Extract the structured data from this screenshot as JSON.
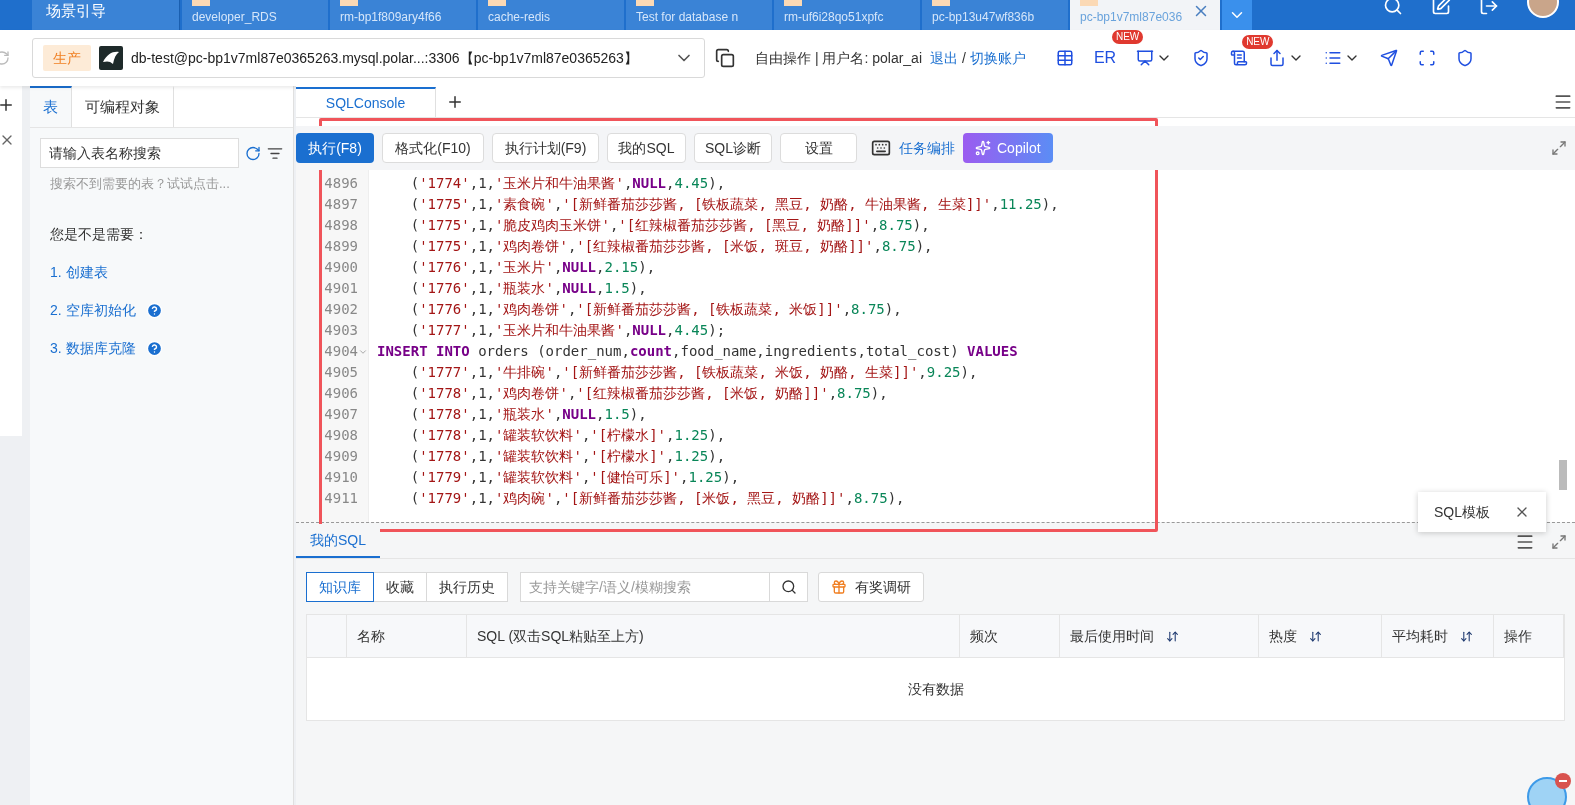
{
  "top_bar": {
    "guide": "场景引导",
    "tabs": [
      {
        "subtitle": "developer_RDS",
        "selected": false
      },
      {
        "subtitle": "rm-bp1f809ary4f66",
        "selected": false
      },
      {
        "subtitle": "cache-redis",
        "selected": false
      },
      {
        "subtitle": "Test for database n",
        "selected": false
      },
      {
        "subtitle": "rm-uf6i28qo51xpfc",
        "selected": false
      },
      {
        "subtitle": "pc-bp13u47wf836b",
        "selected": false
      },
      {
        "subtitle": "pc-bp1v7ml87e036",
        "selected": true
      }
    ]
  },
  "connection": {
    "env_badge": "生产",
    "address": "db-test@pc-bp1v7ml87e0365263.mysql.polar...:3306【pc-bp1v7ml87e0365263】",
    "mode": "自由操作 | 用户名: polar_ai",
    "logout": "退出",
    "separator": "/",
    "switch_account": "切换账户",
    "er_label": "ER",
    "er_badge": "NEW",
    "notes_badge": "NEW"
  },
  "sidebar": {
    "tabs": [
      {
        "label": "表",
        "selected": true
      },
      {
        "label": "可编程对象",
        "selected": false
      }
    ],
    "search": {
      "placeholder": "请输入表名称搜索"
    },
    "hint": "搜索不到需要的表？试试点击...",
    "suggestion_title": "您是不是需要：",
    "suggestions": [
      {
        "label": "1. 创建表",
        "help": false
      },
      {
        "label": "2. 空库初始化",
        "help": true
      },
      {
        "label": "3. 数据库克隆",
        "help": true
      }
    ]
  },
  "editor": {
    "tabs": [
      {
        "label": "SQLConsole",
        "selected": true
      }
    ],
    "buttons": [
      {
        "label": "执行(F8)",
        "primary": true
      },
      {
        "label": "格式化(F10)",
        "primary": false
      },
      {
        "label": "执行计划(F9)",
        "primary": false
      },
      {
        "label": "我的SQL",
        "primary": false
      },
      {
        "label": "SQL诊断",
        "primary": false
      },
      {
        "label": "设置",
        "primary": false
      }
    ],
    "task_link": "任务编排",
    "copilot": "Copilot",
    "lines": [
      {
        "number": "4896",
        "fold": false,
        "tokens": [
          {
            "kind": "plain",
            "text": "    ("
          },
          {
            "kind": "string",
            "text": "'1774'"
          },
          {
            "kind": "plain",
            "text": ",1,"
          },
          {
            "kind": "string",
            "text": "'玉米片和牛油果酱'"
          },
          {
            "kind": "plain",
            "text": ","
          },
          {
            "kind": "keyword",
            "text": "NULL"
          },
          {
            "kind": "plain",
            "text": ","
          },
          {
            "kind": "number",
            "text": "4.45"
          },
          {
            "kind": "plain",
            "text": "),"
          }
        ]
      },
      {
        "number": "4897",
        "fold": false,
        "tokens": [
          {
            "kind": "plain",
            "text": "    ("
          },
          {
            "kind": "string",
            "text": "'1775'"
          },
          {
            "kind": "plain",
            "text": ",1,"
          },
          {
            "kind": "string",
            "text": "'素食碗'"
          },
          {
            "kind": "plain",
            "text": ","
          },
          {
            "kind": "string",
            "text": "'[新鲜番茄莎莎酱, [铁板蔬菜, 黑豆, 奶酪, 牛油果酱, 生菜]]'"
          },
          {
            "kind": "plain",
            "text": ","
          },
          {
            "kind": "number",
            "text": "11.25"
          },
          {
            "kind": "plain",
            "text": "),"
          }
        ]
      },
      {
        "number": "4898",
        "fold": false,
        "tokens": [
          {
            "kind": "plain",
            "text": "    ("
          },
          {
            "kind": "string",
            "text": "'1775'"
          },
          {
            "kind": "plain",
            "text": ",1,"
          },
          {
            "kind": "string",
            "text": "'脆皮鸡肉玉米饼'"
          },
          {
            "kind": "plain",
            "text": ","
          },
          {
            "kind": "string",
            "text": "'[红辣椒番茄莎莎酱, [黑豆, 奶酪]]'"
          },
          {
            "kind": "plain",
            "text": ","
          },
          {
            "kind": "number",
            "text": "8.75"
          },
          {
            "kind": "plain",
            "text": "),"
          }
        ]
      },
      {
        "number": "4899",
        "fold": false,
        "tokens": [
          {
            "kind": "plain",
            "text": "    ("
          },
          {
            "kind": "string",
            "text": "'1775'"
          },
          {
            "kind": "plain",
            "text": ",1,"
          },
          {
            "kind": "string",
            "text": "'鸡肉卷饼'"
          },
          {
            "kind": "plain",
            "text": ","
          },
          {
            "kind": "string",
            "text": "'[红辣椒番茄莎莎酱, [米饭, 斑豆, 奶酪]]'"
          },
          {
            "kind": "plain",
            "text": ","
          },
          {
            "kind": "number",
            "text": "8.75"
          },
          {
            "kind": "plain",
            "text": "),"
          }
        ]
      },
      {
        "number": "4900",
        "fold": false,
        "tokens": [
          {
            "kind": "plain",
            "text": "    ("
          },
          {
            "kind": "string",
            "text": "'1776'"
          },
          {
            "kind": "plain",
            "text": ",1,"
          },
          {
            "kind": "string",
            "text": "'玉米片'"
          },
          {
            "kind": "plain",
            "text": ","
          },
          {
            "kind": "keyword",
            "text": "NULL"
          },
          {
            "kind": "plain",
            "text": ","
          },
          {
            "kind": "number",
            "text": "2.15"
          },
          {
            "kind": "plain",
            "text": "),"
          }
        ]
      },
      {
        "number": "4901",
        "fold": false,
        "tokens": [
          {
            "kind": "plain",
            "text": "    ("
          },
          {
            "kind": "string",
            "text": "'1776'"
          },
          {
            "kind": "plain",
            "text": ",1,"
          },
          {
            "kind": "string",
            "text": "'瓶装水'"
          },
          {
            "kind": "plain",
            "text": ","
          },
          {
            "kind": "keyword",
            "text": "NULL"
          },
          {
            "kind": "plain",
            "text": ","
          },
          {
            "kind": "number",
            "text": "1.5"
          },
          {
            "kind": "plain",
            "text": "),"
          }
        ]
      },
      {
        "number": "4902",
        "fold": false,
        "tokens": [
          {
            "kind": "plain",
            "text": "    ("
          },
          {
            "kind": "string",
            "text": "'1776'"
          },
          {
            "kind": "plain",
            "text": ",1,"
          },
          {
            "kind": "string",
            "text": "'鸡肉卷饼'"
          },
          {
            "kind": "plain",
            "text": ","
          },
          {
            "kind": "string",
            "text": "'[新鲜番茄莎莎酱, [铁板蔬菜, 米饭]]'"
          },
          {
            "kind": "plain",
            "text": ","
          },
          {
            "kind": "number",
            "text": "8.75"
          },
          {
            "kind": "plain",
            "text": "),"
          }
        ]
      },
      {
        "number": "4903",
        "fold": false,
        "tokens": [
          {
            "kind": "plain",
            "text": "    ("
          },
          {
            "kind": "string",
            "text": "'1777'"
          },
          {
            "kind": "plain",
            "text": ",1,"
          },
          {
            "kind": "string",
            "text": "'玉米片和牛油果酱'"
          },
          {
            "kind": "plain",
            "text": ","
          },
          {
            "kind": "keyword",
            "text": "NULL"
          },
          {
            "kind": "plain",
            "text": ","
          },
          {
            "kind": "number",
            "text": "4.45"
          },
          {
            "kind": "plain",
            "text": ");"
          }
        ]
      },
      {
        "number": "4904",
        "fold": true,
        "tokens": [
          {
            "kind": "keyword",
            "text": "INSERT INTO"
          },
          {
            "kind": "plain",
            "text": " orders (order_num,"
          },
          {
            "kind": "keyword",
            "text": "count"
          },
          {
            "kind": "plain",
            "text": ",food_name,ingredients,total_cost) "
          },
          {
            "kind": "keyword",
            "text": "VALUES"
          }
        ]
      },
      {
        "number": "4905",
        "fold": false,
        "tokens": [
          {
            "kind": "plain",
            "text": "    ("
          },
          {
            "kind": "string",
            "text": "'1777'"
          },
          {
            "kind": "plain",
            "text": ",1,"
          },
          {
            "kind": "string",
            "text": "'牛排碗'"
          },
          {
            "kind": "plain",
            "text": ","
          },
          {
            "kind": "string",
            "text": "'[新鲜番茄莎莎酱, [铁板蔬菜, 米饭, 奶酪, 生菜]]'"
          },
          {
            "kind": "plain",
            "text": ","
          },
          {
            "kind": "number",
            "text": "9.25"
          },
          {
            "kind": "plain",
            "text": "),"
          }
        ]
      },
      {
        "number": "4906",
        "fold": false,
        "tokens": [
          {
            "kind": "plain",
            "text": "    ("
          },
          {
            "kind": "string",
            "text": "'1778'"
          },
          {
            "kind": "plain",
            "text": ",1,"
          },
          {
            "kind": "string",
            "text": "'鸡肉卷饼'"
          },
          {
            "kind": "plain",
            "text": ","
          },
          {
            "kind": "string",
            "text": "'[红辣椒番茄莎莎酱, [米饭, 奶酪]]'"
          },
          {
            "kind": "plain",
            "text": ","
          },
          {
            "kind": "number",
            "text": "8.75"
          },
          {
            "kind": "plain",
            "text": "),"
          }
        ]
      },
      {
        "number": "4907",
        "fold": false,
        "tokens": [
          {
            "kind": "plain",
            "text": "    ("
          },
          {
            "kind": "string",
            "text": "'1778'"
          },
          {
            "kind": "plain",
            "text": ",1,"
          },
          {
            "kind": "string",
            "text": "'瓶装水'"
          },
          {
            "kind": "plain",
            "text": ","
          },
          {
            "kind": "keyword",
            "text": "NULL"
          },
          {
            "kind": "plain",
            "text": ","
          },
          {
            "kind": "number",
            "text": "1.5"
          },
          {
            "kind": "plain",
            "text": "),"
          }
        ]
      },
      {
        "number": "4908",
        "fold": false,
        "tokens": [
          {
            "kind": "plain",
            "text": "    ("
          },
          {
            "kind": "string",
            "text": "'1778'"
          },
          {
            "kind": "plain",
            "text": ",1,"
          },
          {
            "kind": "string",
            "text": "'罐装软饮料'"
          },
          {
            "kind": "plain",
            "text": ","
          },
          {
            "kind": "string",
            "text": "'[柠檬水]'"
          },
          {
            "kind": "plain",
            "text": ","
          },
          {
            "kind": "number",
            "text": "1.25"
          },
          {
            "kind": "plain",
            "text": "),"
          }
        ]
      },
      {
        "number": "4909",
        "fold": false,
        "tokens": [
          {
            "kind": "plain",
            "text": "    ("
          },
          {
            "kind": "string",
            "text": "'1778'"
          },
          {
            "kind": "plain",
            "text": ",1,"
          },
          {
            "kind": "string",
            "text": "'罐装软饮料'"
          },
          {
            "kind": "plain",
            "text": ","
          },
          {
            "kind": "string",
            "text": "'[柠檬水]'"
          },
          {
            "kind": "plain",
            "text": ","
          },
          {
            "kind": "number",
            "text": "1.25"
          },
          {
            "kind": "plain",
            "text": "),"
          }
        ]
      },
      {
        "number": "4910",
        "fold": false,
        "tokens": [
          {
            "kind": "plain",
            "text": "    ("
          },
          {
            "kind": "string",
            "text": "'1779'"
          },
          {
            "kind": "plain",
            "text": ",1,"
          },
          {
            "kind": "string",
            "text": "'罐装软饮料'"
          },
          {
            "kind": "plain",
            "text": ","
          },
          {
            "kind": "string",
            "text": "'[健怡可乐]'"
          },
          {
            "kind": "plain",
            "text": ","
          },
          {
            "kind": "number",
            "text": "1.25"
          },
          {
            "kind": "plain",
            "text": "),"
          }
        ]
      },
      {
        "number": "4911",
        "fold": false,
        "tokens": [
          {
            "kind": "plain",
            "text": "    ("
          },
          {
            "kind": "string",
            "text": "'1779'"
          },
          {
            "kind": "plain",
            "text": ",1,"
          },
          {
            "kind": "string",
            "text": "'鸡肉碗'"
          },
          {
            "kind": "plain",
            "text": ","
          },
          {
            "kind": "string",
            "text": "'[新鲜番茄莎莎酱, [米饭, 黑豆, 奶酪]]'"
          },
          {
            "kind": "plain",
            "text": ","
          },
          {
            "kind": "number",
            "text": "8.75"
          },
          {
            "kind": "plain",
            "text": "),"
          }
        ]
      }
    ]
  },
  "template_popup": {
    "label": "SQL模板"
  },
  "my_sql": {
    "tab": "我的SQL",
    "segments": [
      {
        "label": "知识库",
        "selected": true
      },
      {
        "label": "收藏",
        "selected": false
      },
      {
        "label": "执行历史",
        "selected": false
      }
    ],
    "search": {
      "placeholder": "支持关键字/语义/模糊搜索"
    },
    "survey": "有奖调研",
    "columns": [
      {
        "label": "名称",
        "sortable": false
      },
      {
        "label": "SQL (双击SQL粘贴至上方)",
        "sortable": false
      },
      {
        "label": "频次",
        "sortable": false
      },
      {
        "label": "最后使用时间",
        "sortable": true
      },
      {
        "label": "热度",
        "sortable": true
      },
      {
        "label": "平均耗时",
        "sortable": true
      },
      {
        "label": "操作",
        "sortable": false
      }
    ],
    "empty": "没有数据"
  }
}
